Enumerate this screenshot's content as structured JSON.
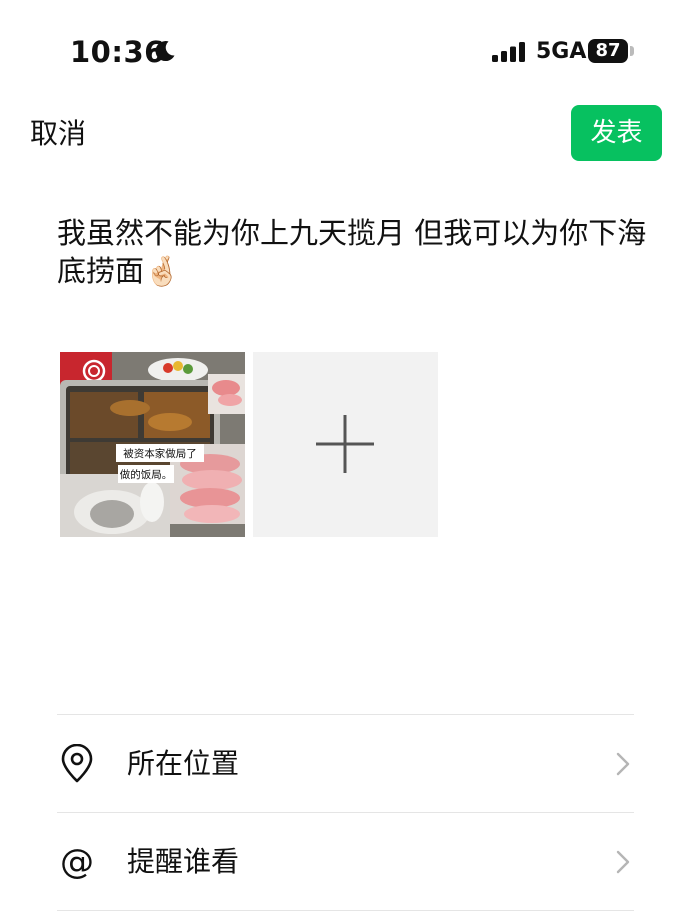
{
  "status_bar": {
    "time": "10:36",
    "moon_icon": "moon-icon",
    "signal_icon": "cellular-signal-icon",
    "network": "5GA",
    "battery": "87"
  },
  "header": {
    "cancel_label": "取消",
    "publish_label": "发表",
    "publish_color": "#07c160"
  },
  "post": {
    "text": "我虽然不能为你上九天揽月 但我可以为你下海底捞面🤞🏻"
  },
  "photos": {
    "thumbnail_caption_line1": "被资本家做局了",
    "thumbnail_caption_line2": "做的饭局。",
    "add_icon": "plus-icon"
  },
  "options": [
    {
      "label": "所在位置",
      "icon": "location-pin-icon"
    },
    {
      "label": "提醒谁看",
      "icon": "at-icon"
    }
  ]
}
